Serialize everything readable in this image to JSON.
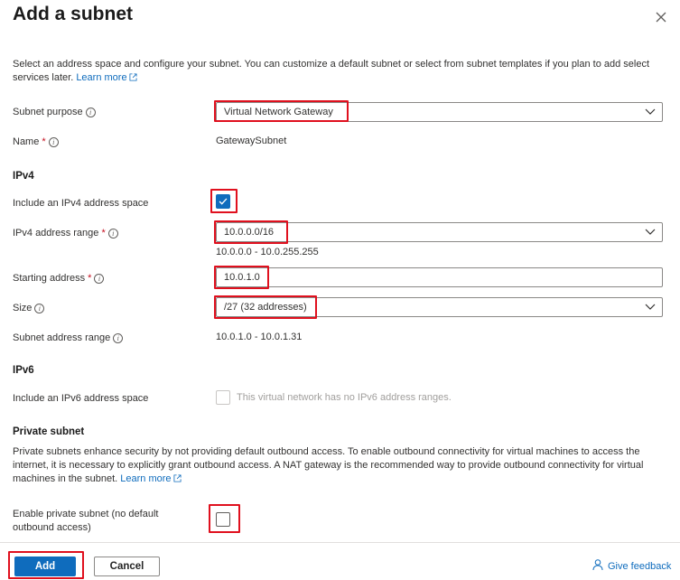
{
  "header": {
    "title": "Add a subnet"
  },
  "intro": {
    "text": "Select an address space and configure your subnet. You can customize a default subnet or select from subnet templates if you plan to add select services later.",
    "learn_more": "Learn more"
  },
  "form": {
    "subnet_purpose": {
      "label": "Subnet purpose",
      "value": "Virtual Network Gateway"
    },
    "name": {
      "label": "Name",
      "required_mark": "*",
      "value": "GatewaySubnet"
    },
    "ipv4_section": "IPv4",
    "include_ipv4": {
      "label": "Include an IPv4 address space",
      "checked": true
    },
    "ipv4_range": {
      "label": "IPv4 address range",
      "required_mark": "*",
      "value": "10.0.0.0/16",
      "hint": "10.0.0.0 - 10.0.255.255"
    },
    "starting_address": {
      "label": "Starting address",
      "required_mark": "*",
      "value": "10.0.1.0"
    },
    "size": {
      "label": "Size",
      "value": "/27 (32 addresses)"
    },
    "subnet_range": {
      "label": "Subnet address range",
      "value": "10.0.1.0 - 10.0.1.31"
    },
    "ipv6_section": "IPv6",
    "include_ipv6": {
      "label": "Include an IPv6 address space",
      "checked": false,
      "disabled_text": "This virtual network has no IPv6 address ranges."
    },
    "private_section": "Private subnet",
    "private_desc": "Private subnets enhance security by not providing default outbound access. To enable outbound connectivity for virtual machines to access the internet, it is necessary to explicitly grant outbound access. A NAT gateway is the recommended way to provide outbound connectivity for virtual machines in the subnet.",
    "private_learn_more": "Learn more",
    "enable_private": {
      "label_line1": "Enable private subnet (no default",
      "label_line2": "outbound access)",
      "checked": false
    }
  },
  "footer": {
    "add_label": "Add",
    "cancel_label": "Cancel",
    "feedback_label": "Give feedback"
  },
  "colors": {
    "accent": "#0f6cbd",
    "highlight": "#e0101e"
  }
}
